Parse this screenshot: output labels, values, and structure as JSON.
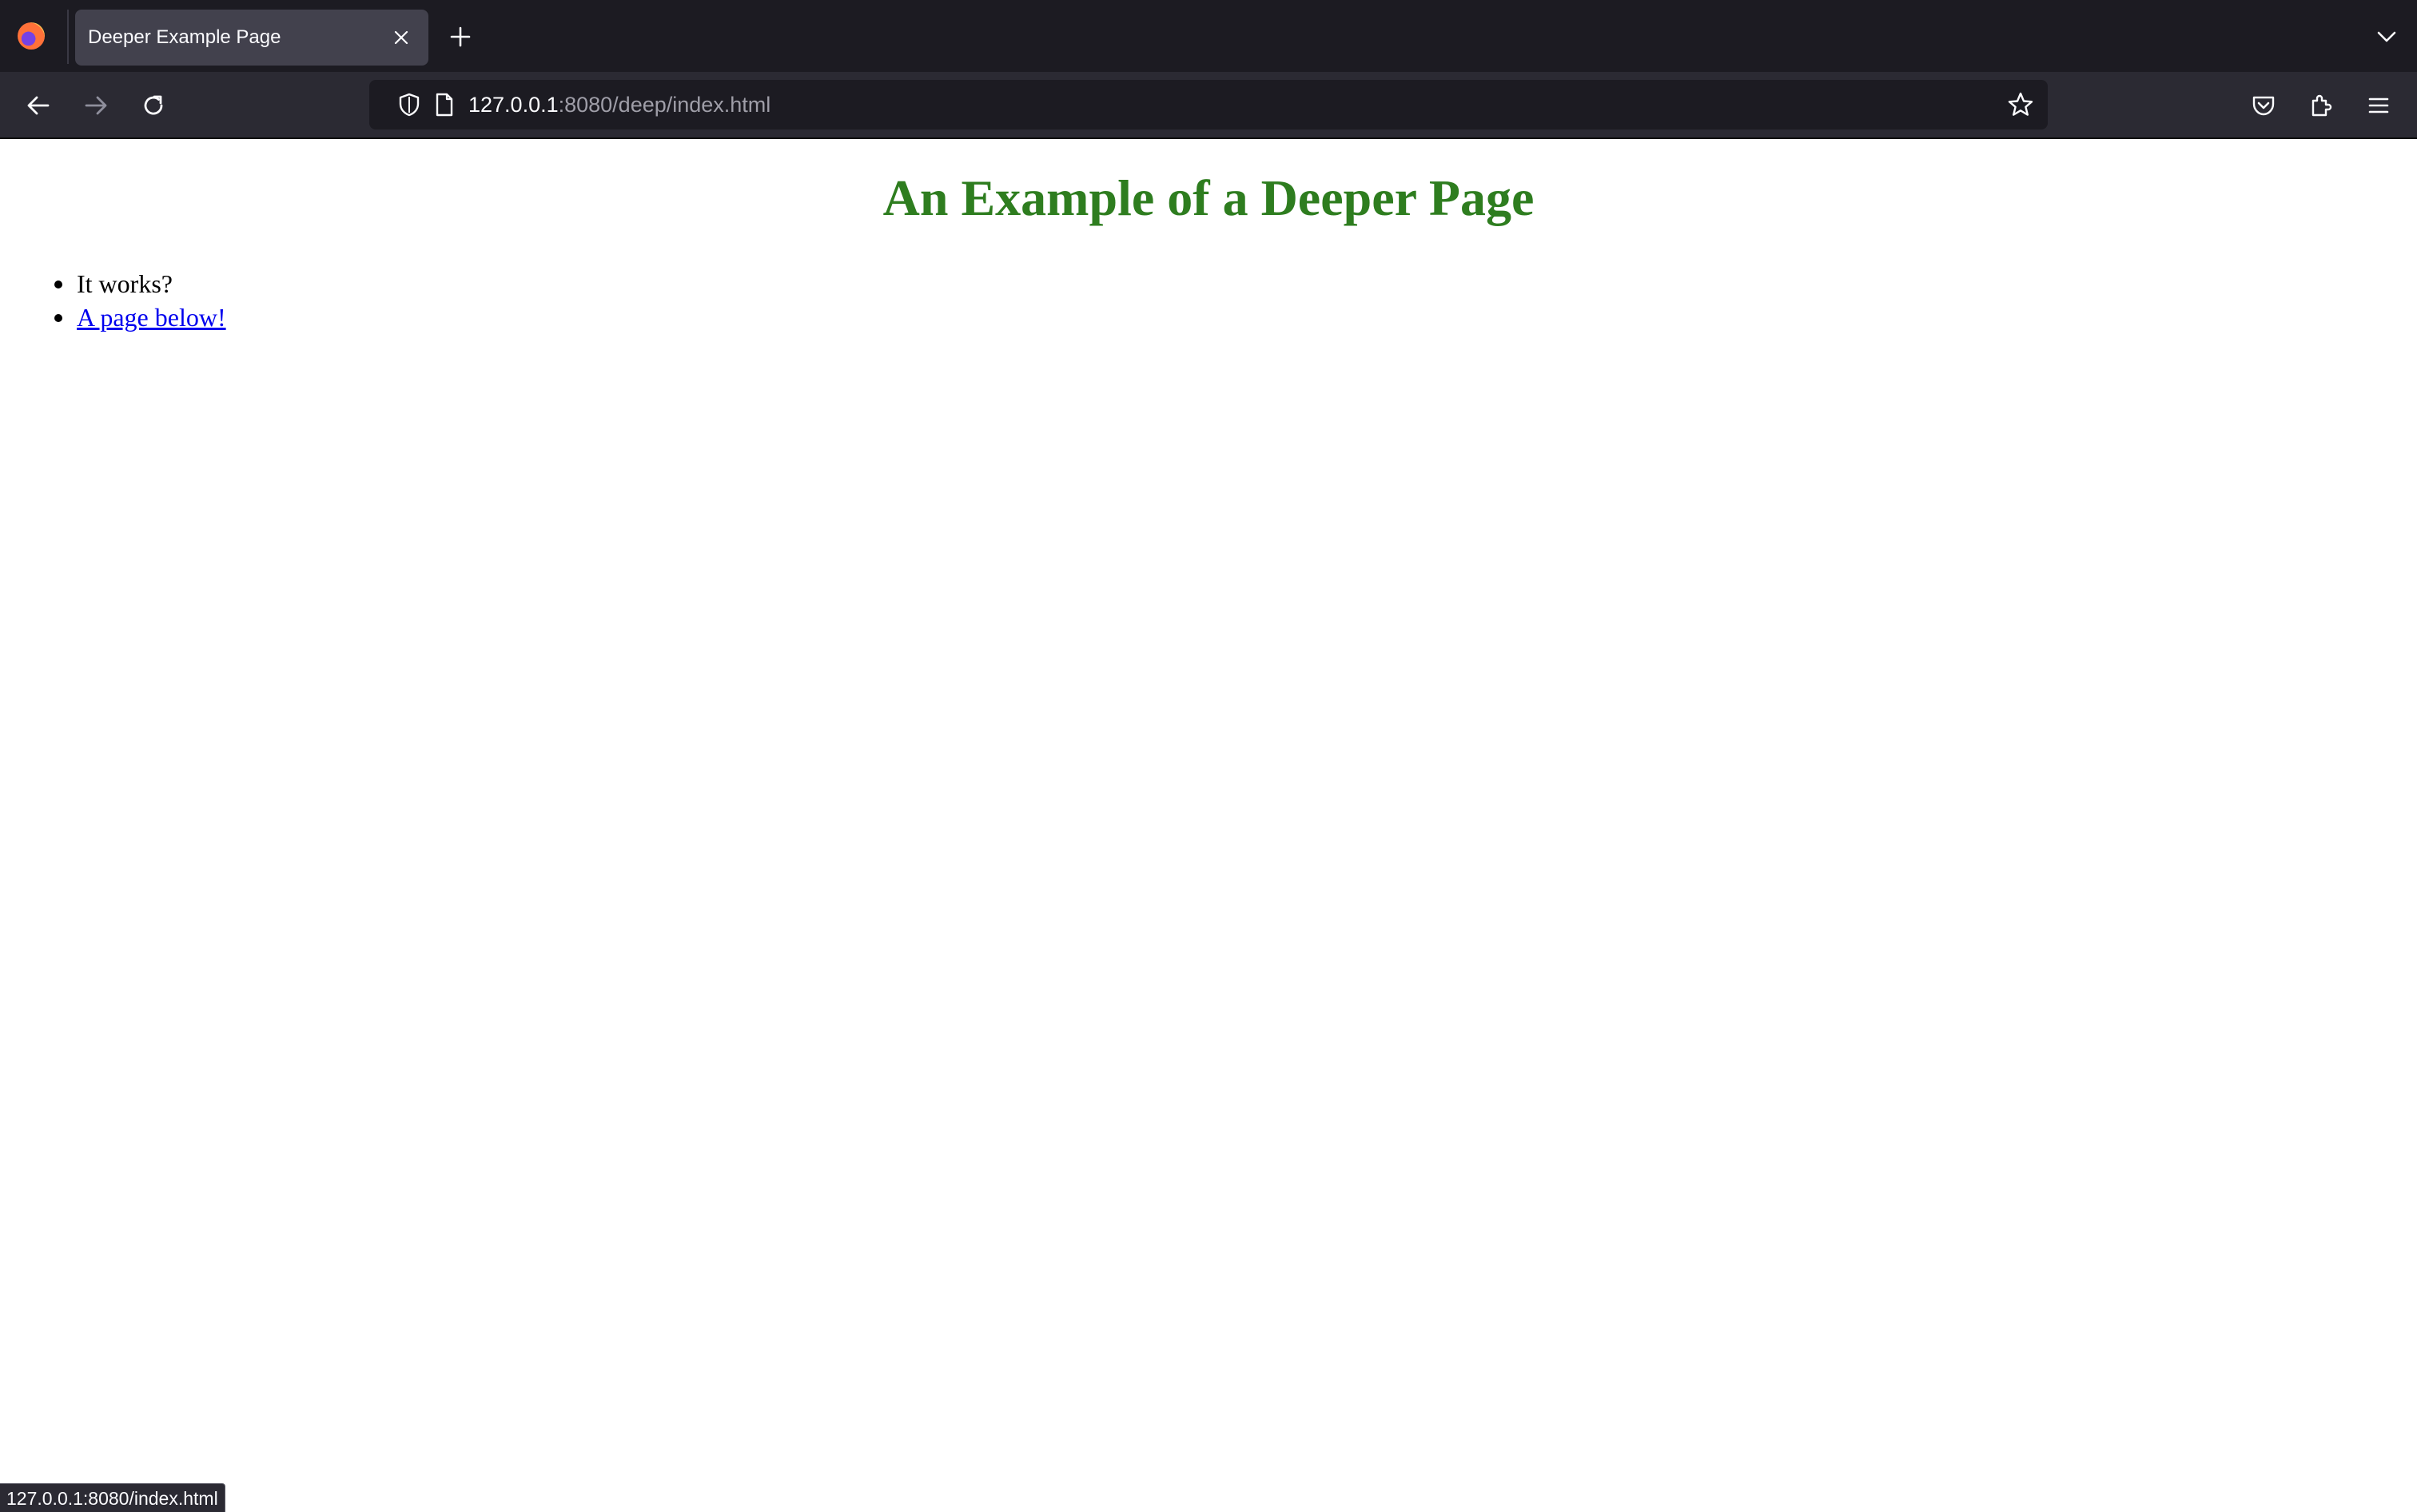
{
  "browser": {
    "tab": {
      "title": "Deeper Example Page"
    },
    "urlbar": {
      "host": "127.0.0.1",
      "rest": ":8080/deep/index.html"
    },
    "status_text": "127.0.0.1:8080/index.html"
  },
  "page": {
    "heading": "An Example of a Deeper Page",
    "list_items": [
      {
        "text": "It works?"
      },
      {
        "text": "A page below!"
      }
    ]
  },
  "colors": {
    "heading": "#2e7d1f",
    "link": "#0000ee",
    "chrome_dark": "#1c1b22",
    "toolbar": "#2b2a33",
    "active_tab": "#42414d"
  },
  "icons": {
    "app_logo": "firefox-logo-icon",
    "tab_close": "close-icon",
    "new_tab": "plus-icon",
    "tab_list": "chevron-down-icon",
    "back": "back-arrow-icon",
    "forward": "forward-arrow-icon",
    "reload": "reload-icon",
    "tracking": "shield-icon",
    "page_info": "page-icon",
    "bookmark": "star-icon",
    "pocket": "pocket-icon",
    "extensions": "puzzle-piece-icon",
    "menu": "hamburger-menu-icon"
  }
}
